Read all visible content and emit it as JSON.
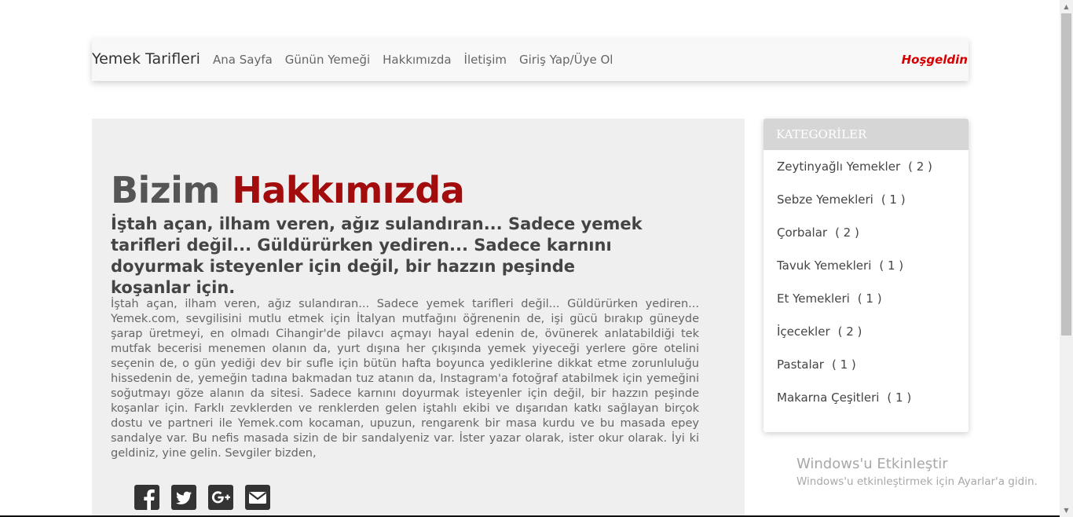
{
  "navbar": {
    "brand": "Yemek Tarifleri",
    "links": [
      "Ana Sayfa",
      "Günün Yemeği",
      "Hakkımızda",
      "İletişim",
      "Giriş Yap/Üye Ol"
    ],
    "welcome": "Hoşgeldin"
  },
  "main": {
    "title_part1": "Bizim",
    "title_part2": "Hakkımızda",
    "subtitle": "İştah açan, ilham veren, ağız sulandıran... Sadece yemek tarifleri değil... Güldürürken yediren... Sadece karnını doyurmak isteyenler için değil, bir hazzın peşinde koşanlar için.",
    "body": "İştah açan, ilham veren, ağız sulandıran... Sadece yemek tarifleri değil... Güldürürken yediren... Yemek.com, sevgilisini mutlu etmek için İtalyan mutfağını öğrenenin de, işi gücü bırakıp güneyde şarap üretmeyi, en olmadı Cihangir'de pilavcı açmayı hayal edenin de, övünerek anlatabildiği tek mutfak becerisi menemen olanın da, yurt dışına her çıkışında yemek yiyeceği yerlere göre otelini seçenin de, o gün yediği dev bir sufle için bütün hafta boyunca yediklerine dikkat etme zorunluluğu hissedenin de, yemeğin tadına bakmadan tuz atanın da, Instagram'a fotoğraf atabilmek için yemeğini soğutmayı göze alanın da sitesi. Sadece karnını doyurmak isteyenler için değil, bir hazzın peşinde koşanlar için. Farklı zevklerden ve renklerden gelen iştahlı ekibi ve dışarıdan katkı sağlayan birçok dostu ve partneri ile Yemek.com kocaman, upuzun, rengarenk bir masa kurdu ve bu masada epey sandalye var. Bu nefis masada sizin de bir sandalyeniz var. İster yazar olarak, ister okur olarak. İyi ki geldiniz, yine gelin. Sevgiler bizden,",
    "social_icons": [
      "facebook-icon",
      "twitter-icon",
      "google-plus-icon",
      "envelope-icon"
    ]
  },
  "sidebar": {
    "header": "KATEGORİLER",
    "categories": [
      {
        "name": "Zeytinyağlı Yemekler",
        "count": "( 2 )"
      },
      {
        "name": "Sebze Yemekleri",
        "count": "( 1 )"
      },
      {
        "name": "Çorbalar",
        "count": "( 2 )"
      },
      {
        "name": "Tavuk Yemekleri",
        "count": "( 1 )"
      },
      {
        "name": "Et Yemekleri",
        "count": "( 1 )"
      },
      {
        "name": "İçecekler",
        "count": "( 2 )"
      },
      {
        "name": "Pastalar",
        "count": "( 1 )"
      },
      {
        "name": "Makarna Çeşitleri",
        "count": "( 1 )"
      }
    ]
  },
  "watermark": {
    "title": "Windows'u Etkinleştir",
    "subtitle": "Windows'u etkinleştirmek için Ayarlar'a gidin."
  },
  "colors": {
    "accent": "#a30c0c",
    "welcome": "#d60000",
    "sidebar_header_bg": "#d6d6d6",
    "panel_bg": "#efefef"
  }
}
